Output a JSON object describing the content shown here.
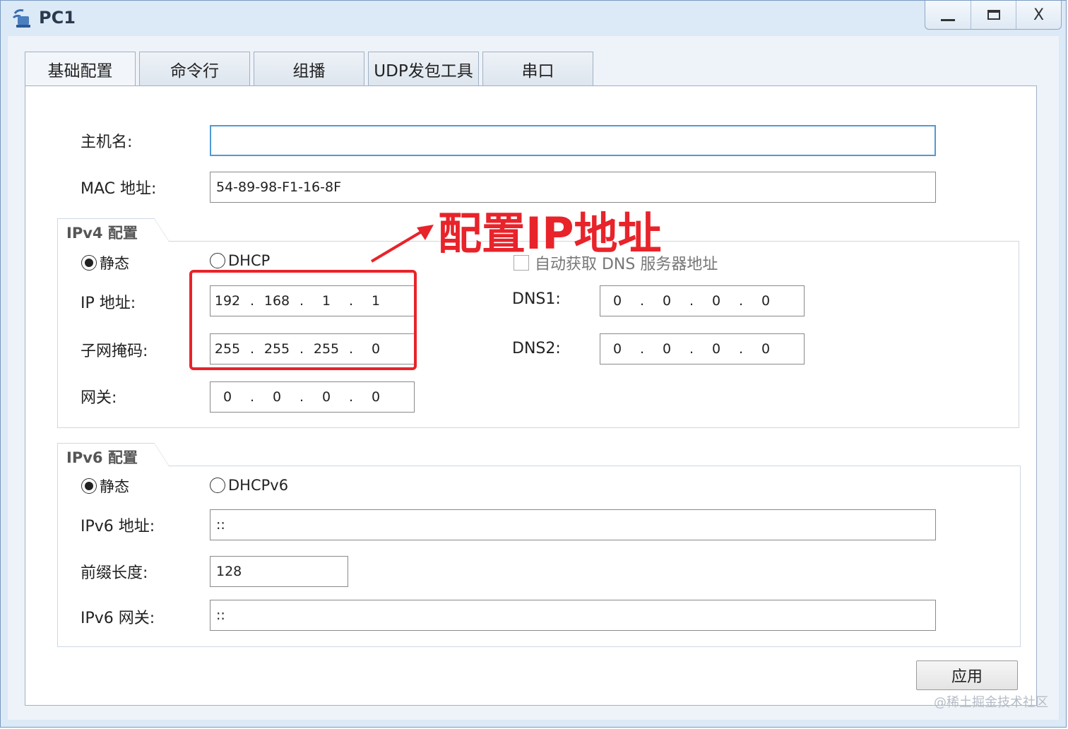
{
  "window": {
    "title": "PC1",
    "controls": {
      "minimize": "",
      "maximize": "",
      "close": "X"
    }
  },
  "tabs": [
    {
      "label": "基础配置",
      "active": true
    },
    {
      "label": "命令行",
      "active": false
    },
    {
      "label": "组播",
      "active": false
    },
    {
      "label": "UDP发包工具",
      "active": false
    },
    {
      "label": "串口",
      "active": false
    }
  ],
  "basic": {
    "hostname_label": "主机名:",
    "hostname_value": "",
    "mac_label": "MAC 地址:",
    "mac_value": "54-89-98-F1-16-8F"
  },
  "ipv4": {
    "group_title": "IPv4 配置",
    "static_label": "静态",
    "static_selected": true,
    "dhcp_label": "DHCP",
    "dhcp_selected": false,
    "auto_dns_label": "自动获取 DNS 服务器地址",
    "auto_dns_checked": false,
    "ip_label": "IP 地址:",
    "ip": [
      "192",
      "168",
      "1",
      "1"
    ],
    "mask_label": "子网掩码:",
    "mask": [
      "255",
      "255",
      "255",
      "0"
    ],
    "gateway_label": "网关:",
    "gateway": [
      "0",
      "0",
      "0",
      "0"
    ],
    "dns1_label": "DNS1:",
    "dns1": [
      "0",
      "0",
      "0",
      "0"
    ],
    "dns2_label": "DNS2:",
    "dns2": [
      "0",
      "0",
      "0",
      "0"
    ]
  },
  "ipv6": {
    "group_title": "IPv6 配置",
    "static_label": "静态",
    "static_selected": true,
    "dhcpv6_label": "DHCPv6",
    "dhcpv6_selected": false,
    "address_label": "IPv6 地址:",
    "address_value": "::",
    "prefix_label": "前缀长度:",
    "prefix_value": "128",
    "gateway_label": "IPv6 网关:",
    "gateway_value": "::"
  },
  "apply_label": "应用",
  "annotation": {
    "text": "配置IP地址",
    "color": "#e8232a"
  },
  "watermark": "@稀土掘金技术社区"
}
